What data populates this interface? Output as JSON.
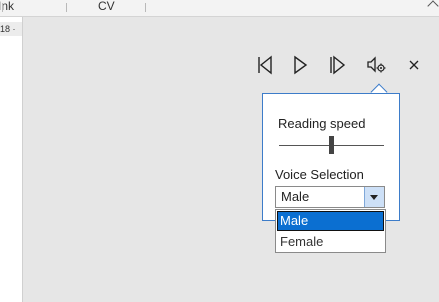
{
  "ribbon": {
    "tabs": [
      "Ink",
      "CV"
    ]
  },
  "ruler": {
    "value": "18"
  },
  "playback": {
    "previous_icon": "previous-paragraph-icon",
    "play_icon": "play-icon",
    "next_icon": "next-paragraph-icon",
    "settings_icon": "voice-settings-icon",
    "close_icon": "close-icon",
    "accent": "#3d7cc9"
  },
  "popup": {
    "speed_label": "Reading speed",
    "speed_level": 0.5,
    "voice_label": "Voice Selection",
    "voice_selected": "Male",
    "voice_options": [
      "Male",
      "Female"
    ],
    "highlight_color": "#0b6fd1"
  }
}
